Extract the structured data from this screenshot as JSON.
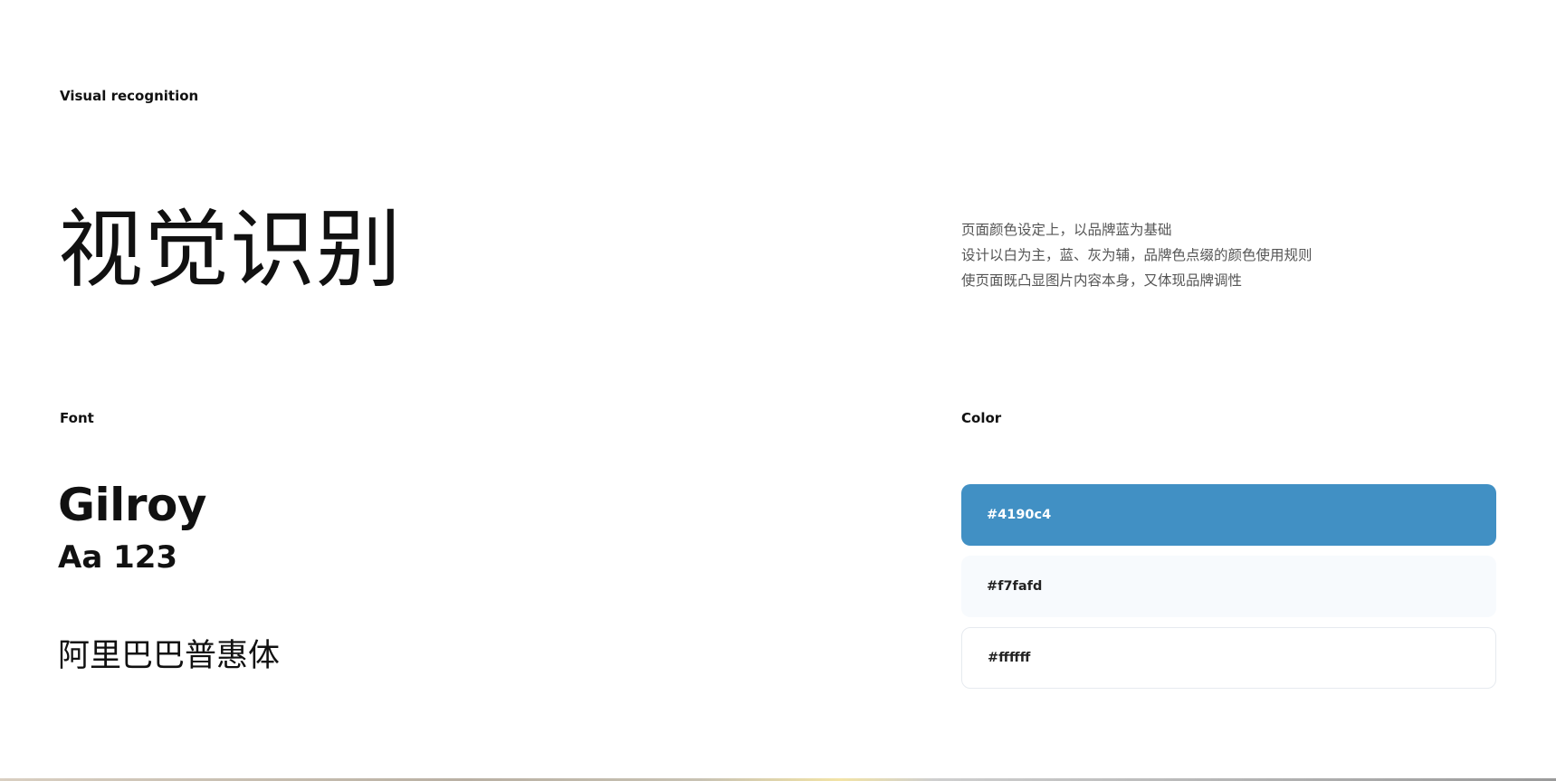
{
  "header": {
    "section_label": "Visual recognition"
  },
  "hero": {
    "title": "视觉识别",
    "description": [
      "页面颜色设定上，以品牌蓝为基础",
      "设计以白为主，蓝、灰为辅，品牌色点缀的颜色使用规则",
      "使页面既凸显图片内容本身，又体现品牌调性"
    ]
  },
  "font_section": {
    "label": "Font",
    "name": "Gilroy",
    "sample": "Aa 123",
    "chinese_font": "阿里巴巴普惠体"
  },
  "color_section": {
    "label": "Color",
    "swatches": [
      {
        "hex_label": "#4190c4",
        "background": "#4190c4",
        "text_color": "#ffffff"
      },
      {
        "hex_label": "#f7fafd",
        "background": "#f7fafd",
        "text_color": "#222222"
      },
      {
        "hex_label": "#ffffff",
        "background": "#ffffff",
        "text_color": "#222222"
      }
    ]
  }
}
